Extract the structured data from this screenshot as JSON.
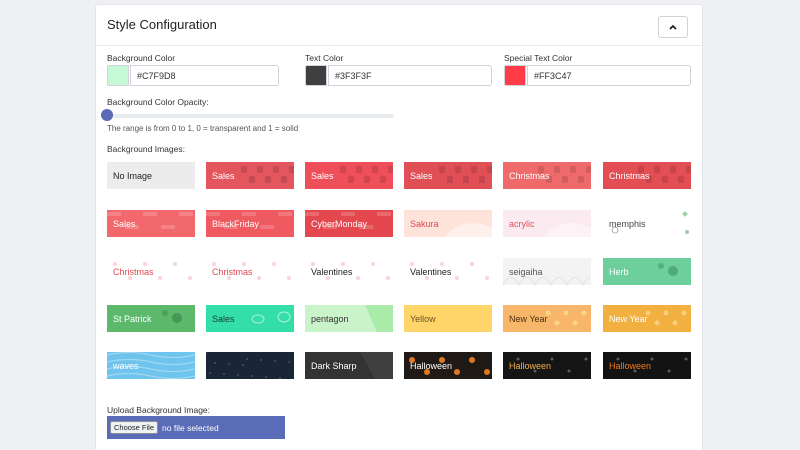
{
  "card": {
    "title": "Style Configuration",
    "collapse_icon": "chevron-up-icon"
  },
  "colors": [
    {
      "label": "Background Color",
      "value": "#C7F9D8",
      "swatch": "#C7F9D8"
    },
    {
      "label": "Text Color",
      "value": "#3F3F3F",
      "swatch": "#3F3F3F"
    },
    {
      "label": "Special Text Color",
      "value": "#FF3C47",
      "swatch": "#FF3C47"
    }
  ],
  "opacity": {
    "label": "Background Color Opacity:",
    "value": 0,
    "hint": "The range is from 0 to 1, 0 = transparent and 1 = solid"
  },
  "background_images": {
    "label": "Background Images:",
    "items": [
      {
        "label": "No Image",
        "bg": "#ececec",
        "fg": "#222",
        "deco": "none"
      },
      {
        "label": "Sales",
        "bg": "#e3565e",
        "fg": "#ffffff",
        "deco": "bags"
      },
      {
        "label": "Sales",
        "bg": "#ee4f5a",
        "fg": "#ffffff",
        "deco": "tags"
      },
      {
        "label": "Sales",
        "bg": "#e04f56",
        "fg": "#ffffff",
        "deco": "stripes"
      },
      {
        "label": "Christmas",
        "bg": "#ef6b6b",
        "fg": "#ffffff",
        "deco": "snow"
      },
      {
        "label": "Christmas",
        "bg": "#e34e55",
        "fg": "#ffffff",
        "deco": "gifts"
      },
      {
        "label": "Sales",
        "bg": "#f3686c",
        "fg": "#ffffff",
        "deco": "text"
      },
      {
        "label": "BlackFriday",
        "bg": "#ee5a60",
        "fg": "#ffffff",
        "deco": "text"
      },
      {
        "label": "CyberMonday",
        "bg": "#e5474f",
        "fg": "#ffffff",
        "deco": "text"
      },
      {
        "label": "Sakura",
        "bg": "#fde3da",
        "fg": "#e04a52",
        "deco": "petals"
      },
      {
        "label": "acrylic",
        "bg": "#fbeaf0",
        "fg": "#e0505a",
        "deco": "wave"
      },
      {
        "label": "memphis",
        "bg": "#ffffff",
        "fg": "#444444",
        "deco": "memphis"
      },
      {
        "label": "Christmas",
        "bg": "#ffffff",
        "fg": "#e04a52",
        "deco": "xmas-light"
      },
      {
        "label": "Christmas",
        "bg": "#ffffff",
        "fg": "#e04a52",
        "deco": "candy"
      },
      {
        "label": "Valentines",
        "bg": "#ffffff",
        "fg": "#222222",
        "deco": "hearts"
      },
      {
        "label": "Valentines",
        "bg": "#ffffff",
        "fg": "#222222",
        "deco": "hearts2"
      },
      {
        "label": "seigaiha",
        "bg": "#f3f3f3",
        "fg": "#555555",
        "deco": "seigaiha"
      },
      {
        "label": "Herb",
        "bg": "#6ccf9c",
        "fg": "#ffffff",
        "deco": "leaves"
      },
      {
        "label": "St Patrick",
        "bg": "#5cb96c",
        "fg": "#ffffff",
        "deco": "clover"
      },
      {
        "label": "Sales",
        "bg": "#33dea9",
        "fg": "#1b3b35",
        "deco": "piggy"
      },
      {
        "label": "pentagon",
        "bg": "#c9f3c9",
        "fg": "#333333",
        "deco": "pentagon"
      },
      {
        "label": "Yellow",
        "bg": "#ffd56a",
        "fg": "#6a5220",
        "deco": "none"
      },
      {
        "label": "New Year",
        "bg": "#f8b66a",
        "fg": "#4a3010",
        "deco": "lanterns"
      },
      {
        "label": "New Year",
        "bg": "#f1b03f",
        "fg": "#ffffff",
        "deco": "fireworks"
      },
      {
        "label": "waves",
        "bg": "#6ec4ec",
        "fg": "#ffffff",
        "deco": "waves"
      },
      {
        "label": "",
        "bg": "#1a2638",
        "fg": "#ffffff",
        "deco": "stars"
      },
      {
        "label": "Dark Sharp",
        "bg": "#333333",
        "fg": "#ffffff",
        "deco": "sharp"
      },
      {
        "label": "Halloween",
        "bg": "#1f1a15",
        "fg": "#ffffff",
        "deco": "pumpkins"
      },
      {
        "label": "Halloween",
        "bg": "#151515",
        "fg": "#f3b04a",
        "deco": "ghost"
      },
      {
        "label": "Halloween",
        "bg": "#131313",
        "fg": "#f07b1c",
        "deco": "dots"
      }
    ]
  },
  "upload": {
    "label": "Upload Background Image:",
    "button_label": "Choose File",
    "status": "no file selected"
  }
}
